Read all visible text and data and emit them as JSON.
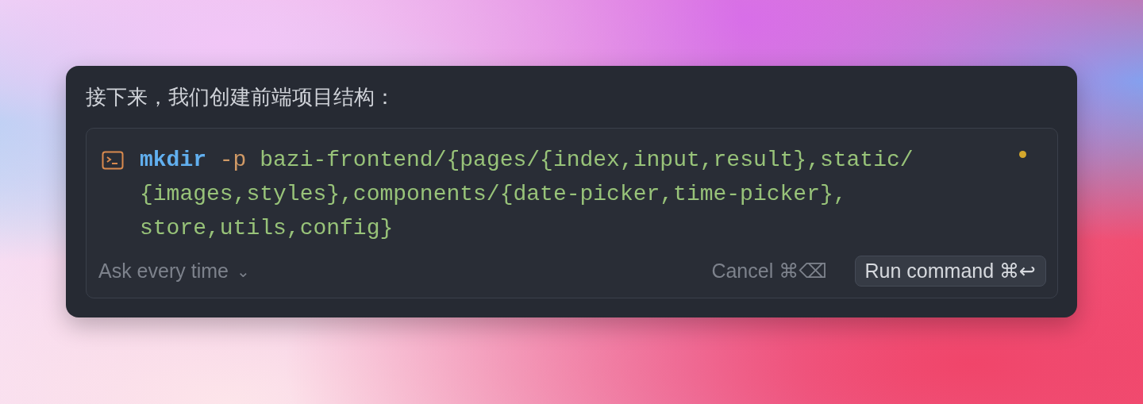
{
  "message": "接下来，我们创建前端项目结构：",
  "command": {
    "lines": [
      [
        {
          "kind": "command",
          "text": "mkdir"
        },
        {
          "kind": "flag",
          "text": " -p"
        },
        {
          "kind": "argument",
          "text": " bazi-frontend/{pages/{index,input,result},static/"
        }
      ],
      [
        {
          "kind": "argument",
          "text": "{images,styles},components/{date-picker,time-picker},"
        }
      ],
      [
        {
          "kind": "argument",
          "text": "store,utils,config}"
        }
      ]
    ],
    "pending": true
  },
  "approval": {
    "label": "Ask every time",
    "caret": "⌄"
  },
  "buttons": [
    {
      "kind": "ghost",
      "label": "Cancel",
      "shortcut": "⌘⌫"
    },
    {
      "kind": "primary",
      "label": "Run command",
      "shortcut": "⌘↩"
    }
  ]
}
